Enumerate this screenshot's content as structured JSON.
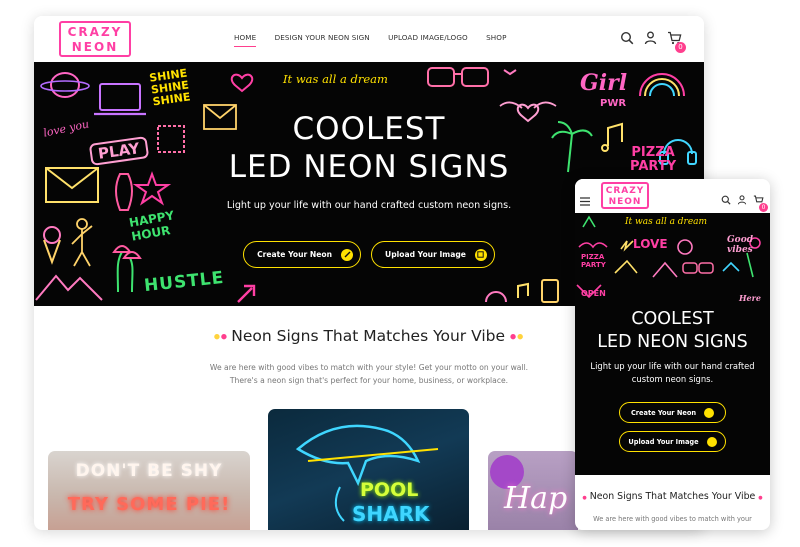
{
  "brand": {
    "logo_line1": "CRAZY",
    "logo_line2": "NEON"
  },
  "nav": {
    "items": [
      "HOME",
      "DESIGN YOUR NEON SIGN",
      "UPLOAD IMAGE/LOGO",
      "SHOP"
    ],
    "active": "HOME"
  },
  "header_icons": {
    "search": "search-icon",
    "account": "user-icon",
    "cart": "cart-icon",
    "cart_count": "0"
  },
  "hero": {
    "title_line1": "COOLEST",
    "title_line2": "LED NEON SIGNS",
    "subtitle": "Light up your life with our hand crafted custom neon signs.",
    "btn_create": "Create Your Neon",
    "btn_upload": "Upload Your Image",
    "neon_texts": {
      "shine": "SHINE",
      "dream": "It was all a dream",
      "girl": "Girl",
      "pwr": "PWR",
      "love_you": "love you",
      "play": "PLAY",
      "pizza": "PIZZA",
      "party": "PARTY",
      "happy": "HAPPY",
      "hour": "HOUR",
      "hustle": "HUSTLE"
    }
  },
  "section": {
    "heading": "Neon Signs That Matches Your Vibe",
    "blurb_line1": "We are here with good vibes to match with your style! Get your motto on your wall.",
    "blurb_line2": "There's a neon sign that's perfect for your home, business, or workplace."
  },
  "products": {
    "card1_line1": "DON'T BE SHY",
    "card1_line2": "TRY SOME PIE!",
    "card2_line1": "POOL",
    "card2_line2": "SHARK",
    "card3_text": "Hap"
  },
  "mobile": {
    "title_line1": "COOLEST",
    "title_line2": "LED NEON SIGNS",
    "subtitle_line1": "Light up your life with our hand crafted",
    "subtitle_line2": "custom neon signs.",
    "btn_create": "Create Your Neon",
    "btn_upload": "Upload Your Image",
    "heading": "Neon Signs That Matches Your Vibe",
    "blurb": "We are here with good vibes to match with your",
    "neon_texts": {
      "dream": "It was all a dream",
      "love": "LOVE",
      "good": "Good",
      "vibes": "vibes",
      "pizza": "PIZZA",
      "party": "PARTY",
      "open": "OPEN",
      "here": "Here"
    }
  },
  "colors": {
    "accent_pink": "#ff3f8e",
    "neon_yellow": "#ffe100",
    "hero_bg": "#050505"
  }
}
